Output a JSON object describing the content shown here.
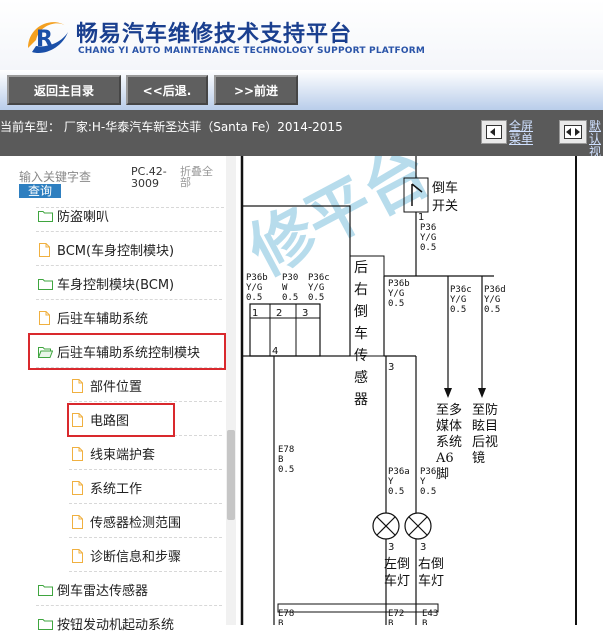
{
  "header": {
    "title": "畅易汽车维修技术支持平台",
    "subtitle": "CHANG YI AUTO MAINTENANCE TECHNOLOGY SUPPORT PLATFORM"
  },
  "toolbar": {
    "home_label": "返回主目录",
    "back_label": "<<后退.",
    "forward_label": ">>前进"
  },
  "vehicle": {
    "text": "当前车型： 厂家:H-华泰汽车新圣达菲（Santa Fe）2014-2015"
  },
  "view_controls": {
    "fullscreen_label": "全屏菜单",
    "dual_label": "默认视图"
  },
  "sidebar": {
    "search_placeholder": "输入关键字查",
    "search_button": "查询",
    "code": "PC.42-3009",
    "collapse_all": "折叠全部",
    "items": [
      {
        "label": "防盗喇叭",
        "icon": "folder-icon"
      },
      {
        "label": "BCM(车身控制模块)",
        "icon": "document-icon"
      },
      {
        "label": "车身控制模块(BCM)",
        "icon": "folder-icon"
      },
      {
        "label": "后驻车辅助系统",
        "icon": "document-icon"
      },
      {
        "label": "后驻车辅助系统控制模块",
        "icon": "folder-open-icon"
      },
      {
        "label": "部件位置",
        "icon": "document-icon"
      },
      {
        "label": "电路图",
        "icon": "document-icon"
      },
      {
        "label": "线束端护套",
        "icon": "document-icon"
      },
      {
        "label": "系统工作",
        "icon": "document-icon"
      },
      {
        "label": "传感器检测范围",
        "icon": "document-icon"
      },
      {
        "label": "诊断信息和步骤",
        "icon": "document-icon"
      },
      {
        "label": "倒车雷达传感器",
        "icon": "folder-icon"
      },
      {
        "label": "按钮发动机起动系统",
        "icon": "folder-icon"
      }
    ]
  },
  "diagram": {
    "watermark": "修平台",
    "reverse_switch": "倒车开关",
    "module_label": "后右倒车传感器",
    "media_label": "至多媒体系统A6脚",
    "mirror_label": "至防眩目后视镜",
    "left_lamp": "左倒车灯",
    "right_lamp": "右倒车灯",
    "wires": {
      "p36b_left": "P36b Y/G 0.5",
      "p30": "P30 W 0.5",
      "p36c_left": "P36c Y/G 0.5",
      "p36b": "P36b Y/G 0.5",
      "p36c": "P36c Y/G 0.5",
      "p36d": "P36d Y/G 0.5",
      "p36_top": "P36 Y/G 0.5",
      "e78_upper": "E78 B 0.5",
      "p36a": "P36a Y 0.5",
      "p36_lower": "P36 Y 0.5",
      "e78_lower": "E78 B",
      "e72": "E72 B",
      "e43": "E43 B"
    },
    "pins": [
      "1",
      "2",
      "3",
      "4",
      "1",
      "3",
      "3",
      "3"
    ]
  },
  "colors": {
    "brand_blue": "#1a3f8f",
    "nav_button": "#5f5f5f",
    "info_bar": "#5a5a5a",
    "highlight_red": "#d9292d",
    "folder_green": "#3fa53f",
    "document_orange": "#f0b040",
    "query_blue": "#2e7fc0"
  }
}
